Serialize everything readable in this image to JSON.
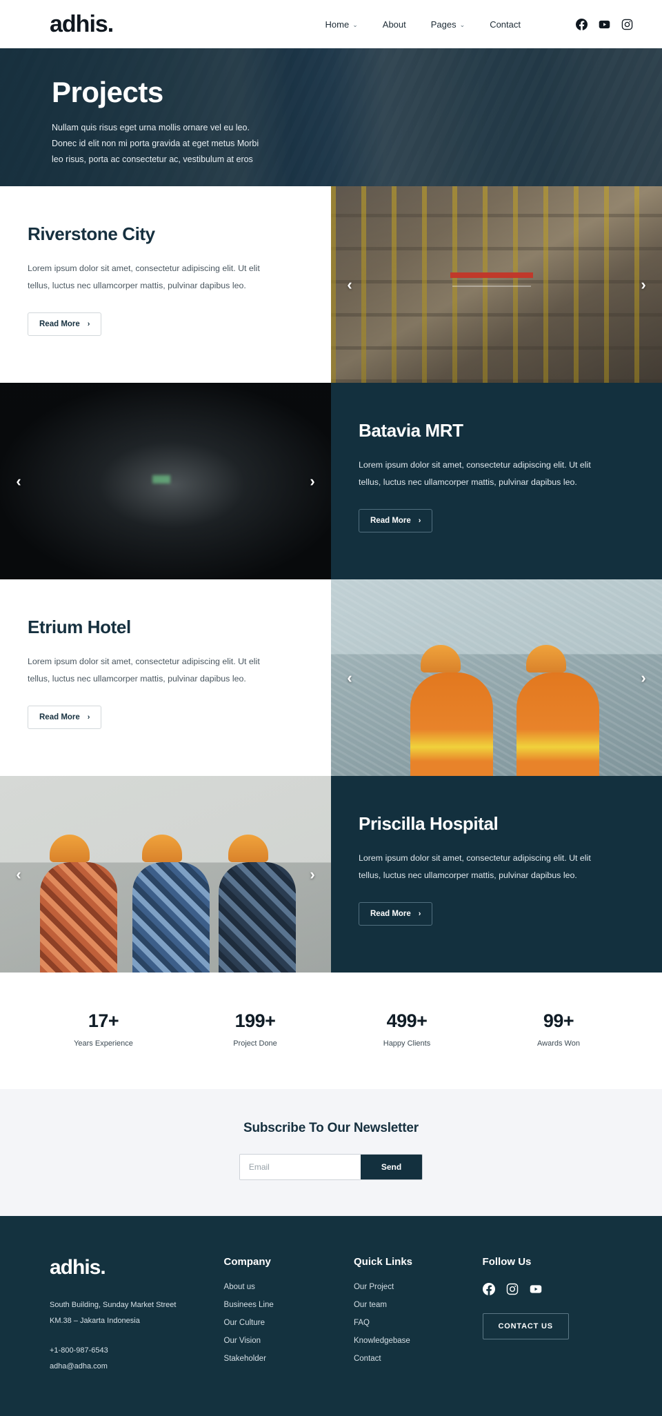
{
  "header": {
    "brand": "adhis.",
    "nav": [
      {
        "label": "Home",
        "has_dropdown": true
      },
      {
        "label": "About",
        "has_dropdown": false
      },
      {
        "label": "Pages",
        "has_dropdown": true
      },
      {
        "label": "Contact",
        "has_dropdown": false
      }
    ],
    "socials": [
      "facebook-icon",
      "youtube-icon",
      "instagram-icon"
    ],
    "caret": "⌄"
  },
  "hero": {
    "title": "Projects",
    "line1": "Nullam quis risus eget urna mollis ornare vel eu leo.",
    "line2": "Donec id elit non mi porta gravida at eget metus Morbi",
    "line3": "leo risus, porta ac consectetur ac, vestibulum at eros"
  },
  "projects": [
    {
      "title": "Riverstone City",
      "desc": "Lorem ipsum dolor sit amet, consectetur adipiscing elit. Ut elit tellus, luctus nec ullamcorper mattis, pulvinar dapibus leo.",
      "button": "Read More",
      "arrow": "›",
      "prev": "‹",
      "next": "›",
      "theme": "light",
      "image": "construction-steel-frame-photo"
    },
    {
      "title": "Batavia MRT",
      "desc": "Lorem ipsum dolor sit amet, consectetur adipiscing elit. Ut elit tellus, luctus nec ullamcorper mattis, pulvinar dapibus leo.",
      "button": "Read More",
      "arrow": "›",
      "prev": "‹",
      "next": "›",
      "theme": "dark",
      "image": "subway-tunnel-photo"
    },
    {
      "title": "Etrium Hotel",
      "desc": "Lorem ipsum dolor sit amet, consectetur adipiscing elit. Ut elit tellus, luctus nec ullamcorper mattis, pulvinar dapibus leo.",
      "button": "Read More",
      "arrow": "›",
      "prev": "‹",
      "next": "›",
      "theme": "light",
      "image": "two-workers-orange-vests-photo"
    },
    {
      "title": "Priscilla Hospital",
      "desc": "Lorem ipsum dolor sit amet, consectetur adipiscing elit. Ut elit tellus, luctus nec ullamcorper mattis, pulvinar dapibus leo.",
      "button": "Read More",
      "arrow": "›",
      "prev": "‹",
      "next": "›",
      "theme": "dark",
      "image": "three-workers-blueprint-photo"
    }
  ],
  "stats": [
    {
      "value": "17+",
      "label": "Years Experience"
    },
    {
      "value": "199+",
      "label": "Project Done"
    },
    {
      "value": "499+",
      "label": "Happy Clients"
    },
    {
      "value": "99+",
      "label": "Awards Won"
    }
  ],
  "newsletter": {
    "title": "Subscribe To Our Newsletter",
    "placeholder": "Email",
    "value": "",
    "send": "Send"
  },
  "footer": {
    "brand": "adhis.",
    "address_line1": "South Building, Sunday Market Street",
    "address_line2": "KM.38 – Jakarta Indonesia",
    "phone": "+1-800-987-6543",
    "email": "adha@adha.com",
    "company": {
      "head": "Company",
      "links": [
        "About us",
        "Businees Line",
        "Our Culture",
        "Our Vision",
        "Stakeholder"
      ]
    },
    "quick_links": {
      "head": "Quick Links",
      "links": [
        "Our Project",
        "Our team",
        "FAQ",
        "Knowledgebase",
        "Contact"
      ]
    },
    "follow": {
      "head": "Follow Us",
      "socials": [
        "facebook-icon",
        "instagram-icon",
        "youtube-icon"
      ],
      "contact_button": "CONTACT US"
    }
  },
  "colors": {
    "navy": "#13303e",
    "footer_navy": "#14323f",
    "newsletter_bg": "#f4f5f8",
    "text_dark": "#16303f"
  }
}
